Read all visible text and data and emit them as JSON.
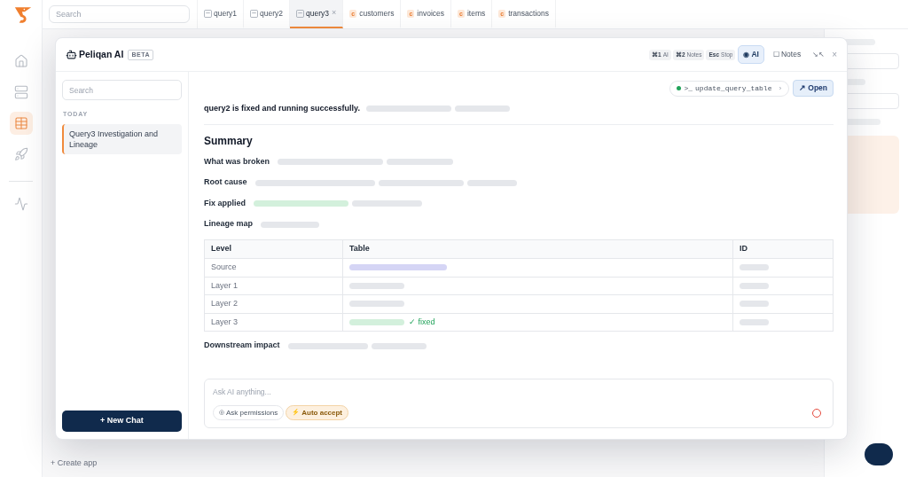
{
  "rail": {
    "items": [
      {
        "selected": false
      },
      {
        "selected": false
      },
      {
        "selected": true
      },
      {
        "selected": false
      }
    ],
    "footer_items": [
      {
        "selected": false
      }
    ]
  },
  "top_bar": {
    "search": {
      "placeholder": "Search"
    },
    "tabs": [
      {
        "kind": "query",
        "label": "query1",
        "selected": false
      },
      {
        "kind": "query",
        "label": "query2",
        "selected": false
      },
      {
        "kind": "query",
        "label": "query3",
        "selected": true,
        "close": "×"
      },
      {
        "kind": "table",
        "badge": "c",
        "label": "customers",
        "selected": false
      },
      {
        "kind": "table",
        "badge": "c",
        "label": "invoices",
        "selected": false
      },
      {
        "kind": "table",
        "badge": "c",
        "label": "items",
        "selected": false
      },
      {
        "kind": "table",
        "badge": "c",
        "label": "transactions",
        "selected": false
      }
    ]
  },
  "main": {
    "create_app": "+ Create app"
  },
  "ai_panel": {
    "title": "Peliqan AI",
    "badge": "BETA",
    "shortcuts": [
      {
        "key": "⌘1",
        "label": "AI"
      },
      {
        "key": "⌘2",
        "label": "Notes"
      },
      {
        "key": "Esc",
        "label": "Stop"
      }
    ],
    "modes": [
      {
        "glyph": "◉",
        "label": "AI",
        "selected": true
      },
      {
        "glyph": "☐",
        "label": "Notes",
        "selected": false
      }
    ],
    "window_controls": [
      {
        "kind": "collapse",
        "glyph": "↘↖"
      },
      {
        "kind": "close",
        "glyph": "×"
      }
    ],
    "sidebar": {
      "search": {
        "placeholder": "Search"
      },
      "section": "TODAY",
      "chats": [
        {
          "title": "Query3 Investigation and Lineage",
          "selected": true
        }
      ],
      "new_chat": "+ New Chat"
    },
    "tool_call": {
      "prefix": ">_",
      "name": "update_query_table",
      "chevron": "›"
    },
    "open_button": {
      "glyph": "↗",
      "label": "Open"
    },
    "headline": {
      "text": "query2 is fixed and running successfully.",
      "bars": [
        {
          "kind": "muted"
        },
        {
          "kind": "muted"
        }
      ]
    },
    "summary": {
      "title": "Summary",
      "rows": [
        {
          "label": "What was broken",
          "bars": [
            {
              "kind": "muted"
            },
            {
              "kind": "muted"
            }
          ]
        },
        {
          "label": "Root cause",
          "bars": [
            {
              "kind": "muted"
            },
            {
              "kind": "muted"
            },
            {
              "kind": "muted"
            }
          ]
        },
        {
          "label": "Fix applied",
          "bars": [
            {
              "kind": "success"
            },
            {
              "kind": "muted"
            }
          ]
        },
        {
          "label": "Lineage map",
          "bars": [
            {
              "kind": "muted"
            }
          ]
        }
      ]
    },
    "lineage_table": {
      "columns": [
        "Level",
        "Table",
        "ID"
      ],
      "rows": [
        {
          "level": "Source",
          "table": [
            {
              "kind": "accent"
            }
          ],
          "id": [
            {
              "kind": "muted"
            }
          ]
        },
        {
          "level": "Layer 1",
          "table": [
            {
              "kind": "muted"
            }
          ],
          "id": [
            {
              "kind": "muted"
            }
          ]
        },
        {
          "level": "Layer 2",
          "table": [
            {
              "kind": "muted"
            }
          ],
          "id": [
            {
              "kind": "muted"
            }
          ]
        },
        {
          "level": "Layer 3",
          "table": [
            {
              "kind": "success"
            }
          ],
          "note": "✓ fixed",
          "id": [
            {
              "kind": "muted"
            }
          ]
        }
      ]
    },
    "downstream": {
      "label": "Downstream impact",
      "bars": [
        {
          "kind": "muted"
        },
        {
          "kind": "muted"
        }
      ]
    },
    "composer": {
      "placeholder": "Ask AI anything...",
      "modes": [
        {
          "glyph": "◎",
          "label": "Ask permissions",
          "selected": false
        },
        {
          "glyph": "⚡",
          "label": "Auto accept",
          "selected": true
        }
      ]
    }
  }
}
